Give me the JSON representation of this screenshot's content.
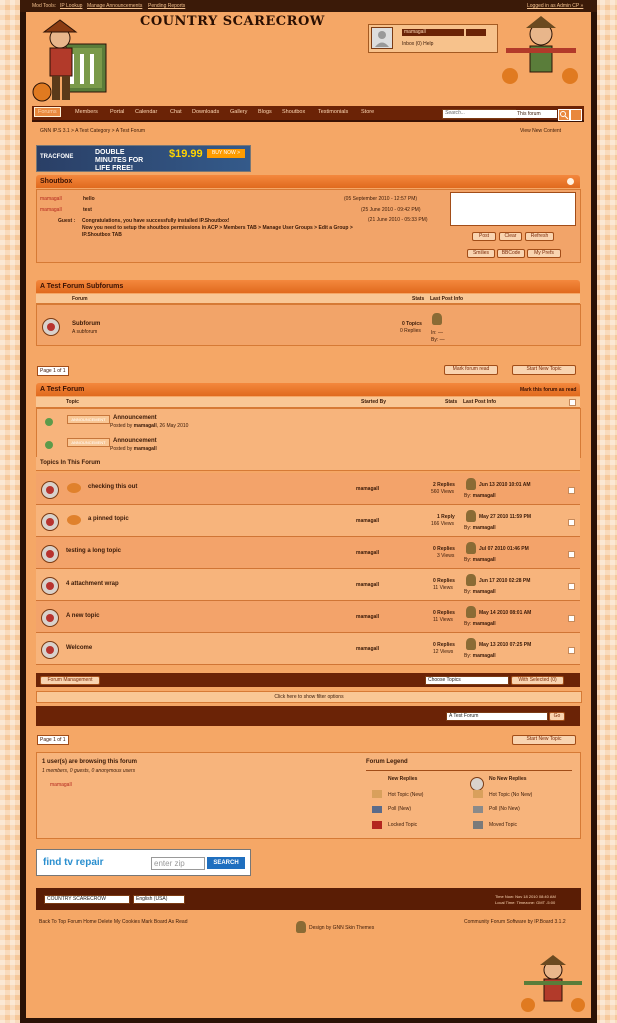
{
  "topbar": {
    "mod_tools": "Mod Tools:",
    "ip_lookup": "IP Lookup",
    "manage_announcements": "Manage Announcements",
    "pending_reports": "Pending Reports",
    "admin_cp": "Logged in as Admin CP »"
  },
  "site": {
    "title": "COUNTRY SCARECROW"
  },
  "userbox": {
    "username": "mamagall",
    "links": "Inbox (0)   Help"
  },
  "nav": {
    "items": [
      "Forums",
      "Members",
      "Portal",
      "Calendar",
      "Chat",
      "Downloads",
      "Gallery",
      "Blogs",
      "Shoutbox",
      "Testimonials",
      "Store"
    ],
    "search_placeholder": "Search...",
    "search_scope": "This forum"
  },
  "breadcrumb": {
    "trail": "GNN  IP.S 3.1  > A Test Category  > A Test Forum",
    "view_new": "View New Content"
  },
  "ad_top": {
    "brand": "TRACFONE",
    "headline": "DOUBLE MINUTES FOR LIFE FREE!",
    "price": "$19.99",
    "cta": "BUY NOW >"
  },
  "shoutbox": {
    "title": "Shoutbox",
    "shouts": [
      {
        "user": "mamagall",
        "text": "hello",
        "time": "(05 September 2010 - 12:57 PM)"
      },
      {
        "user": "mamagall",
        "text": "test",
        "time": "(25 June 2010 - 09:42 PM)"
      }
    ],
    "guest_time": "(21 June 2010 - 05:33 PM)",
    "guest_label": "Guest :",
    "guest_msg_1": "Congratulations, you have successfully installed IP.Shoutbox!",
    "guest_msg_2": "Now you need to setup the shoutbox permissions in ACP  > Members TAB  > Manage User Groups  > Edit a Group  >",
    "guest_msg_3": "IP.Shoutbox TAB",
    "buttons": [
      "Post",
      "Clear",
      "Refresh"
    ],
    "buttons2": [
      "Smilies",
      "BBCode",
      "My Prefs"
    ]
  },
  "subforums": {
    "title": "A Test Forum Subforums",
    "col_forum": "Forum",
    "col_stats": "Stats",
    "col_last": "Last Post Info",
    "name": "Subforum",
    "desc": "A subforum",
    "topics": "0 Topics",
    "replies": "0 Replies",
    "last_in": "In: —",
    "last_by": "By: —"
  },
  "pager": {
    "label": "Page 1 of 1"
  },
  "actions": {
    "mark_read": "Mark forum read",
    "start_new": "Start New Topic"
  },
  "forum": {
    "title": "A Test Forum",
    "mark_read": "Mark this forum as read",
    "col_topic": "Topic",
    "col_started": "Started By",
    "col_stats": "Stats",
    "col_last": "Last Post Info"
  },
  "announcements": [
    {
      "label": "Announcement",
      "tag": "ANNOUNCEMENT",
      "meta": "Posted by",
      "user": "mamagall",
      "date": ", 26 May 2010"
    },
    {
      "label": "Announcement",
      "tag": "ANNOUNCEMENT",
      "meta": "Posted by",
      "user": "mamagall",
      "date": ""
    }
  ],
  "topics_header": "Topics In This Forum",
  "topics": [
    {
      "title": "checking this out",
      "starter": "mamagall",
      "replies": "2 Replies",
      "views": "560 Views",
      "date": "Jun 13 2010 10:01 AM",
      "by": "mamagall"
    },
    {
      "title": "a pinned topic",
      "starter": "mamagall",
      "replies": "1 Reply",
      "views": "166 Views",
      "date": "May 27 2010 11:59 PM",
      "by": "mamagall"
    },
    {
      "title": "testing a long topic",
      "starter": "mamagall",
      "replies": "0 Replies",
      "views": "3 Views",
      "date": "Jul 07 2010 01:46 PM",
      "by": "mamagall"
    },
    {
      "title": "4 attachment wrap",
      "starter": "mamagall",
      "replies": "0 Replies",
      "views": "11 Views",
      "date": "Jun 17 2010 02:28 PM",
      "by": "mamagall"
    },
    {
      "title": "A new topic",
      "starter": "mamagall",
      "replies": "0 Replies",
      "views": "11 Views",
      "date": "May 14 2010 08:01 AM",
      "by": "mamagall"
    },
    {
      "title": "Welcome",
      "starter": "mamagall",
      "replies": "0 Replies",
      "views": "12 Views",
      "date": "May 13 2010 07:25 PM",
      "by": "mamagall"
    }
  ],
  "moderation": {
    "forum_mgmt": "Forum Management",
    "choose": "Choose Topics",
    "with_selected": "With Selected (0)",
    "filter": "Click here to show filter options",
    "jump": "A Test Forum",
    "go": "Go"
  },
  "viewers": {
    "title": "1 user(s) are browsing this forum",
    "detail": "1 members, 0 guests, 0 anonymous users",
    "user": "mamagall"
  },
  "legend": {
    "title": "Forum Legend",
    "new_replies": "New Replies",
    "no_new": "No New Replies",
    "hot_new": "Hot Topic (New)",
    "hot_nonew": "Hot Topic (No New)",
    "poll_new": "Poll (New)",
    "poll_nonew": "Poll (No New)",
    "locked": "Locked Topic",
    "moved": "Moved Topic"
  },
  "ad_bottom": {
    "text": "find tv repair",
    "zip": "enter zip",
    "btn": "SEARCH"
  },
  "footer": {
    "skin": "COUNTRY SCARECROW",
    "lang": "English (USA)",
    "time_line1": "Time Now: Nov 18 2010 08:40 AM",
    "time_line2": "Local Time: Timezone: GMT -5:00",
    "links": "Back To Top  Forum Home  Delete My Cookies  Mark Board As Read",
    "design": "Design by GNN Skin Themes",
    "powered": "Community Forum Software by IP.Board 3.1.2"
  }
}
